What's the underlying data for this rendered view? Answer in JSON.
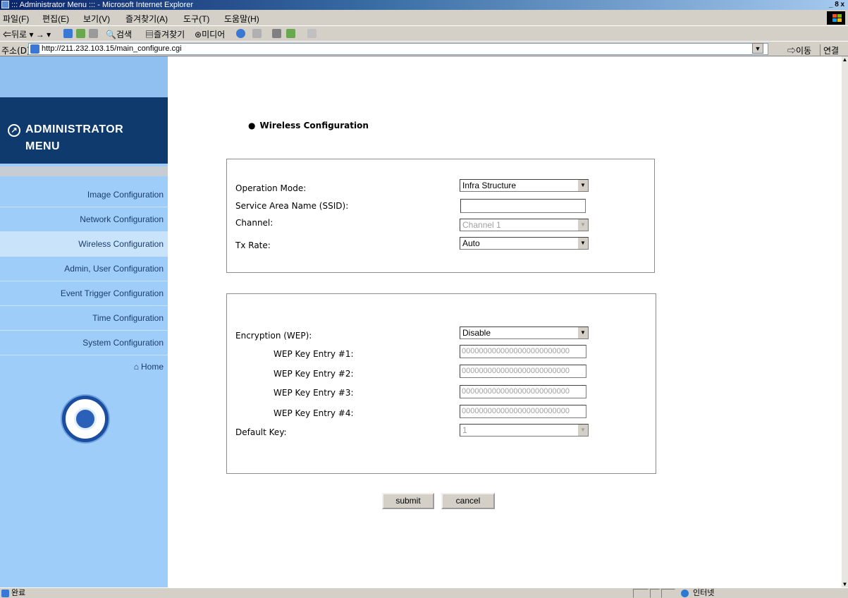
{
  "window": {
    "title": "::: Administrator Menu ::: - Microsoft Internet Explorer",
    "controls": "_ 8 x"
  },
  "menubar": {
    "items": [
      "파일(F)",
      "편집(E)",
      "보기(V)",
      "즐겨찾기(A)",
      "도구(T)",
      "도움말(H)"
    ]
  },
  "toolbar": {
    "back": "뒤로",
    "search": "검색",
    "favorites": "즐겨찾기",
    "media": "미디어"
  },
  "addressbar": {
    "label": "주소(D)",
    "url": "http://211.232.103.15/main_configure.cgi",
    "go": "이동",
    "links": "연결"
  },
  "sidebar": {
    "title_line1": "ADMINISTRATOR",
    "title_line2": "MENU",
    "items": [
      {
        "label": "Image Configuration",
        "active": false
      },
      {
        "label": "Network Configuration",
        "active": false
      },
      {
        "label": "Wireless Configuration",
        "active": true
      },
      {
        "label": "Admin, User Configuration",
        "active": false
      },
      {
        "label": "Event Trigger Configuration",
        "active": false
      },
      {
        "label": "Time Configuration",
        "active": false
      },
      {
        "label": "System Configuration",
        "active": false
      }
    ],
    "home": "Home"
  },
  "main": {
    "heading": "Wireless Configuration",
    "section1": {
      "operation_mode": {
        "label": "Operation Mode:",
        "value": "Infra Structure"
      },
      "ssid": {
        "label": "Service Area Name (SSID):",
        "value": ""
      },
      "channel": {
        "label": "Channel:",
        "value": "Channel 1"
      },
      "tx_rate": {
        "label": "Tx Rate:",
        "value": "Auto"
      }
    },
    "section2": {
      "encryption": {
        "label": "Encryption (WEP):",
        "value": "Disable"
      },
      "wep_keys": [
        {
          "label": "WEP Key Entry #1:",
          "value": "0000000000000000000000000"
        },
        {
          "label": "WEP Key Entry #2:",
          "value": "0000000000000000000000000"
        },
        {
          "label": "WEP Key Entry #3:",
          "value": "0000000000000000000000000"
        },
        {
          "label": "WEP Key Entry #4:",
          "value": "0000000000000000000000000"
        }
      ],
      "default_key": {
        "label": "Default Key:",
        "value": "1"
      }
    },
    "buttons": {
      "submit": "submit",
      "cancel": "cancel"
    }
  },
  "statusbar": {
    "status": "완료",
    "zone": "인터넷"
  }
}
